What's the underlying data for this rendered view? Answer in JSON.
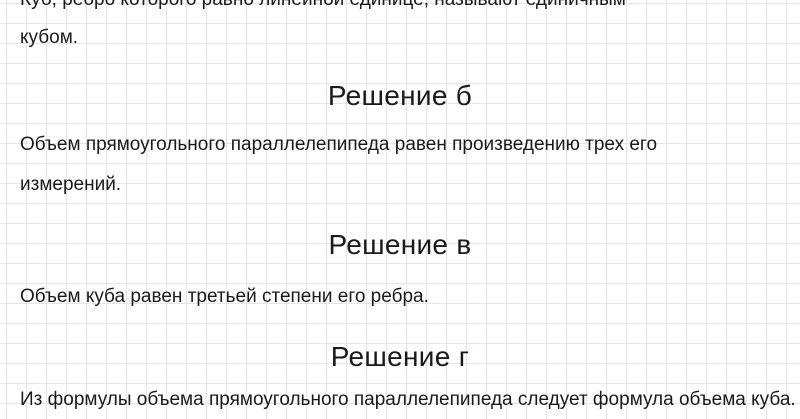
{
  "document": {
    "partial_top_line": "Куб, ребро которого равно линейной единице, называют единичным",
    "intro_end_line": "кубом.",
    "sections": [
      {
        "heading": "Решение б",
        "lines": [
          "Объем прямоугольного параллелепипеда равен произведению трех его",
          "измерений."
        ]
      },
      {
        "heading": "Решение в",
        "lines": [
          "Объем куба равен третьей степени его ребра."
        ]
      },
      {
        "heading": "Решение г",
        "lines": [
          "Из формулы объема прямоугольного параллелепипеда следует формула объема куба."
        ]
      }
    ]
  }
}
